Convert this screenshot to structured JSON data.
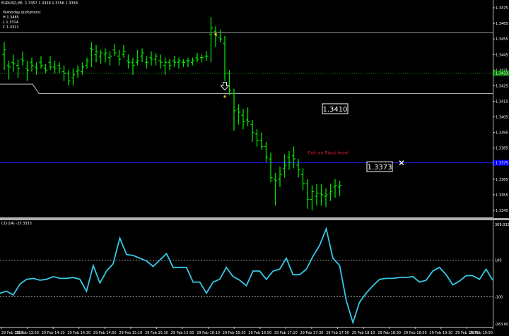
{
  "symbol_header": "EURUSD,M5  1.3357 1.3359 1.3356 1.3358",
  "yesterday": {
    "title": "Yesterday quotations:",
    "high": "H 1.3485",
    "low": "L 1.3314",
    "close": "C 1.3321"
  },
  "price_axis": {
    "min": 1.334,
    "max": 1.348,
    "ticks": [
      "1.3475",
      "1.3465",
      "1.3455",
      "1.3445",
      "1.3435",
      "1.3425",
      "1.3415",
      "1.3405",
      "1.3395",
      "1.3385",
      "1.3375",
      "1.3365",
      "1.3355",
      "1.3345"
    ],
    "current_price_label": "1.3375",
    "green_level_label": "1.3433"
  },
  "levels": {
    "yesterday_high": 1.3459,
    "green_dotted": 1.3433,
    "blue_line": 1.33755,
    "silver_lower": [
      1.3426,
      1.3426,
      1.342,
      1.342
    ]
  },
  "annotations": {
    "entry_price": "1.3410",
    "exit_price": "1.3373",
    "exit_text": "Exit on Pivot level",
    "entry_arrow_icon": "down-arrow-icon",
    "exit_marker_icon": "x-cross-icon"
  },
  "colors": {
    "bars": "#00e000",
    "cci_line": "#36c9e6",
    "blue_level": "#2020ff",
    "exit_text": "#e0203a",
    "silver": "#c0c0c0",
    "axis_box_bg": "#0000ff",
    "green_box_bg": "#008000"
  },
  "chart_data": [
    {
      "type": "ohlc",
      "title": "EURUSD,M5",
      "series": [
        {
          "name": "EURUSD,M5",
          "values": [
            [
              1.3445,
              1.3453,
              1.3435,
              1.3448
            ],
            [
              1.3438,
              1.3441,
              1.3429,
              1.3437
            ],
            [
              1.344,
              1.3445,
              1.3434,
              1.3439
            ],
            [
              1.3438,
              1.3442,
              1.343,
              1.3436
            ],
            [
              1.3442,
              1.3447,
              1.3438,
              1.3441
            ],
            [
              1.3436,
              1.3441,
              1.3428,
              1.3435
            ],
            [
              1.344,
              1.3443,
              1.3434,
              1.3438
            ],
            [
              1.3437,
              1.344,
              1.3432,
              1.3436
            ],
            [
              1.344,
              1.3444,
              1.3436,
              1.3438
            ],
            [
              1.3436,
              1.3439,
              1.3433,
              1.3435
            ],
            [
              1.344,
              1.3444,
              1.3435,
              1.3437
            ],
            [
              1.3437,
              1.3441,
              1.3433,
              1.3436
            ],
            [
              1.3438,
              1.344,
              1.3433,
              1.3436
            ],
            [
              1.3434,
              1.3438,
              1.3428,
              1.3433
            ],
            [
              1.3433,
              1.3435,
              1.3425,
              1.3428
            ],
            [
              1.343,
              1.3436,
              1.3425,
              1.3432
            ],
            [
              1.3434,
              1.3438,
              1.343,
              1.3435
            ],
            [
              1.3434,
              1.344,
              1.3432,
              1.3437
            ],
            [
              1.3438,
              1.3443,
              1.3436,
              1.3441
            ],
            [
              1.3449,
              1.3453,
              1.3437,
              1.3448
            ],
            [
              1.3445,
              1.3451,
              1.344,
              1.3447
            ],
            [
              1.3444,
              1.3448,
              1.3439,
              1.3446
            ],
            [
              1.3445,
              1.3449,
              1.344,
              1.3446
            ],
            [
              1.3443,
              1.3447,
              1.3438,
              1.3444
            ],
            [
              1.3448,
              1.3452,
              1.3444,
              1.3446
            ],
            [
              1.3444,
              1.3448,
              1.3438,
              1.3442
            ],
            [
              1.3445,
              1.3451,
              1.3443,
              1.3447
            ],
            [
              1.3441,
              1.3445,
              1.3436,
              1.344
            ],
            [
              1.344,
              1.3443,
              1.3432,
              1.3438
            ],
            [
              1.344,
              1.3448,
              1.3438,
              1.3441
            ],
            [
              1.3444,
              1.3449,
              1.344,
              1.3446
            ],
            [
              1.344,
              1.3444,
              1.3436,
              1.344
            ],
            [
              1.3443,
              1.3447,
              1.3438,
              1.3442
            ],
            [
              1.3442,
              1.3446,
              1.3438,
              1.3444
            ],
            [
              1.3441,
              1.3445,
              1.3436,
              1.344
            ],
            [
              1.3438,
              1.3443,
              1.3432,
              1.344
            ],
            [
              1.344,
              1.3442,
              1.3435,
              1.3438
            ],
            [
              1.3441,
              1.3444,
              1.3437,
              1.344
            ],
            [
              1.344,
              1.3443,
              1.3436,
              1.3441
            ],
            [
              1.344,
              1.3442,
              1.3437,
              1.344
            ],
            [
              1.3441,
              1.3443,
              1.3437,
              1.3441
            ],
            [
              1.344,
              1.3443,
              1.3438,
              1.3441
            ],
            [
              1.3443,
              1.3446,
              1.344,
              1.3442
            ],
            [
              1.3443,
              1.3445,
              1.344,
              1.3443
            ],
            [
              1.3444,
              1.3447,
              1.3441,
              1.3444
            ],
            [
              1.3458,
              1.3469,
              1.344,
              1.3462
            ],
            [
              1.346,
              1.3463,
              1.345,
              1.3457
            ],
            [
              1.3456,
              1.3461,
              1.3453,
              1.3455
            ],
            [
              1.3452,
              1.3457,
              1.3428,
              1.3433
            ],
            [
              1.3433,
              1.3435,
              1.3419,
              1.3422
            ],
            [
              1.342,
              1.3423,
              1.3396,
              1.3409
            ],
            [
              1.341,
              1.3413,
              1.34,
              1.3408
            ],
            [
              1.3406,
              1.341,
              1.3397,
              1.3402
            ],
            [
              1.3403,
              1.3411,
              1.3399,
              1.3402
            ],
            [
              1.34,
              1.3403,
              1.3389,
              1.3395
            ],
            [
              1.3394,
              1.3397,
              1.3386,
              1.339
            ],
            [
              1.339,
              1.3395,
              1.3384,
              1.3386
            ],
            [
              1.3386,
              1.3389,
              1.3376,
              1.3379
            ],
            [
              1.3378,
              1.3382,
              1.3363,
              1.3366
            ],
            [
              1.3365,
              1.3369,
              1.3348,
              1.3364
            ],
            [
              1.3365,
              1.3373,
              1.336,
              1.3368
            ],
            [
              1.3372,
              1.3381,
              1.3366,
              1.3374
            ],
            [
              1.3379,
              1.3383,
              1.3371,
              1.3376
            ],
            [
              1.338,
              1.3386,
              1.3372,
              1.3378
            ],
            [
              1.3374,
              1.3378,
              1.3366,
              1.3371
            ],
            [
              1.3368,
              1.3372,
              1.3358,
              1.3362
            ],
            [
              1.3362,
              1.3365,
              1.3346,
              1.3352
            ],
            [
              1.3352,
              1.3361,
              1.3345,
              1.3357
            ],
            [
              1.3354,
              1.3362,
              1.3348,
              1.3356
            ],
            [
              1.3356,
              1.3362,
              1.3348,
              1.3355
            ],
            [
              1.3354,
              1.3359,
              1.3347,
              1.3355
            ],
            [
              1.3356,
              1.3362,
              1.3351,
              1.3357
            ],
            [
              1.336,
              1.3365,
              1.3353,
              1.3361
            ],
            [
              1.336,
              1.3364,
              1.3354,
              1.3361
            ]
          ]
        }
      ],
      "ylim": [
        1.334,
        1.348
      ]
    },
    {
      "type": "line",
      "title": "CCI(14) -23.3333",
      "series": [
        {
          "name": "CCI(14)",
          "values": [
            -80,
            -70,
            -90,
            -30,
            -5,
            0,
            -10,
            -5,
            10,
            0,
            0,
            5,
            -5,
            -70,
            70,
            -25,
            40,
            80,
            220,
            130,
            125,
            110,
            95,
            65,
            100,
            135,
            60,
            60,
            60,
            -20,
            -20,
            -80,
            -20,
            -5,
            60,
            10,
            -10,
            -40,
            40,
            40,
            -5,
            40,
            50,
            110,
            20,
            20,
            50,
            120,
            180,
            270,
            110,
            70,
            -120,
            -240,
            -130,
            -80,
            -40,
            -5,
            0,
            0,
            5,
            5,
            10,
            -20,
            -10,
            40,
            60,
            20,
            -35,
            -15,
            15,
            15,
            -5,
            50,
            -10
          ],
          "view_min": -263.6,
          "view_max": 309.0
        }
      ],
      "ticks": [
        "309.0320",
        "100",
        "-100",
        "-263.60"
      ],
      "reference_levels": [
        100,
        -100
      ],
      "time_labels": [
        "29 Feb 2012",
        "29 Feb 13:50",
        "29 Feb 14:10",
        "29 Feb 14:30",
        "29 Feb 14:50",
        "29 Feb 15:10",
        "29 Feb 15:30",
        "29 Feb 15:50",
        "29 Feb 16:10",
        "29 Feb 16:30",
        "29 Feb 16:50",
        "29 Feb 17:10",
        "29 Feb 17:30",
        "29 Feb 17:50",
        "29 Feb 18:10",
        "29 Feb 18:30",
        "29 Feb 18:50",
        "29 Feb 19:10",
        "29 Feb 19:30",
        "29 Feb 19:50"
      ]
    }
  ]
}
